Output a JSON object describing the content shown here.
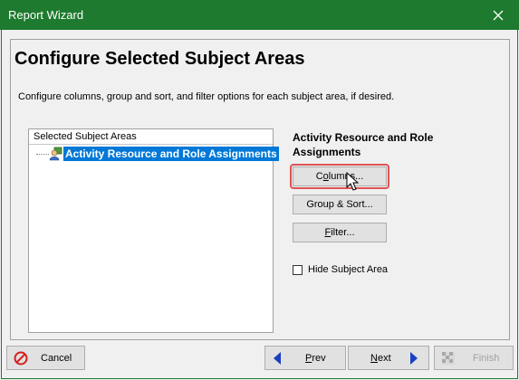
{
  "window": {
    "title": "Report Wizard"
  },
  "page": {
    "heading": "Configure Selected Subject Areas",
    "description": "Configure columns, group and sort, and filter options for each subject area, if desired."
  },
  "subject_list": {
    "header": "Selected Subject Areas",
    "items": [
      {
        "label": "Activity Resource and Role Assignments",
        "selected": true
      }
    ]
  },
  "selected_subject": {
    "name": "Activity Resource and Role Assignments"
  },
  "buttons": {
    "columns": {
      "pre": "C",
      "accel": "o",
      "post": "lumns..."
    },
    "group_sort": "Group & Sort...",
    "filter": {
      "accel": "F",
      "post": "ilter..."
    }
  },
  "hide_subject": {
    "label": "Hide Subject Area",
    "checked": false
  },
  "footer": {
    "cancel": "Cancel",
    "prev": {
      "accel": "P",
      "post": "rev"
    },
    "next": {
      "accel": "N",
      "post": "ext"
    },
    "finish": "Finish"
  },
  "colors": {
    "titlebar": "#1e7a2e",
    "selection": "#0078d7",
    "highlight": "#e05252",
    "nav_arrow": "#1a3fc4"
  }
}
